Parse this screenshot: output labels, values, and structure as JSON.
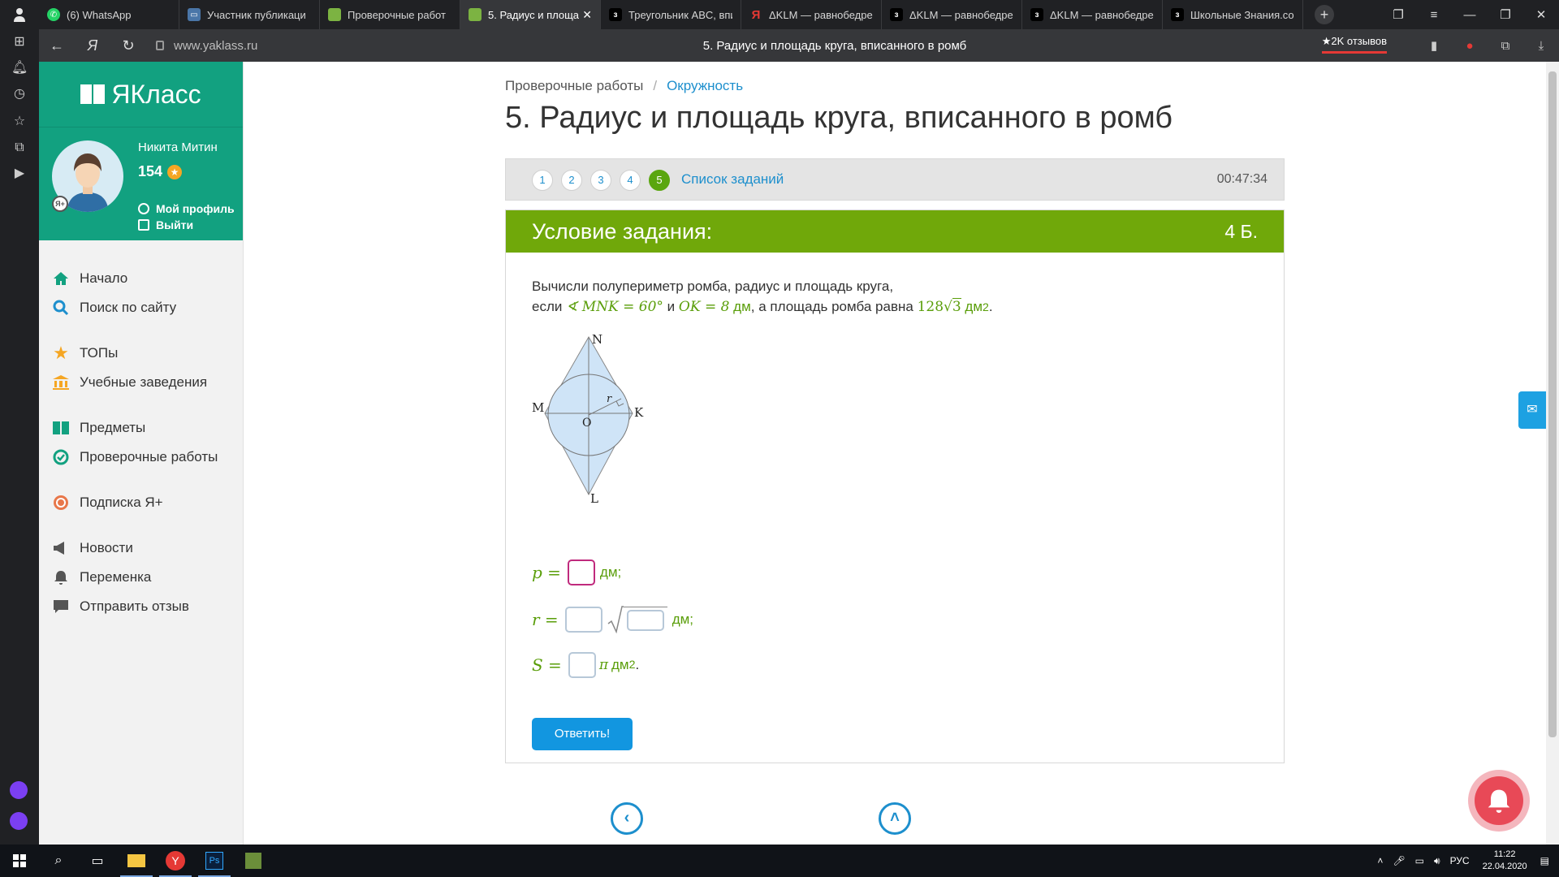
{
  "browser": {
    "tabs": [
      {
        "title": "(6) WhatsApp",
        "favicon": "whatsapp-icon",
        "color": "#25d366"
      },
      {
        "title": "Участник публикаци",
        "favicon": "vk-icon",
        "color": "#4a76a8"
      },
      {
        "title": "Проверочные работ",
        "favicon": "yaklass-icon",
        "color": "#7cb342"
      },
      {
        "title": "5. Радиус и площа,",
        "favicon": "yaklass-icon",
        "color": "#7cb342",
        "active": true
      },
      {
        "title": "Треугольник ABC, впи",
        "favicon": "znania-icon",
        "color": "#222"
      },
      {
        "title": "ΔKLM — равнобедре",
        "favicon": "yandex-icon",
        "color": "#e53935"
      },
      {
        "title": "ΔKLM — равнобедре",
        "favicon": "znania-icon",
        "color": "#222"
      },
      {
        "title": "ΔKLM — равнобедре",
        "favicon": "znania-icon",
        "color": "#222"
      },
      {
        "title": "Школьные Знания.со",
        "favicon": "znania-icon",
        "color": "#222"
      }
    ],
    "url": "www.yaklass.ru",
    "page_title": "5. Радиус и площадь круга, вписанного в ромб",
    "reviews": "★2K отзывов"
  },
  "logo": "ЯКласс",
  "user": {
    "name": "Никита Митин",
    "points": "154",
    "profile_link": "Мой профиль",
    "logout_link": "Выйти"
  },
  "menu": [
    {
      "label": "Начало",
      "icon": "home-icon"
    },
    {
      "label": "Поиск по сайту",
      "icon": "search-icon"
    },
    {
      "label": "ТОПы",
      "icon": "star-icon"
    },
    {
      "label": "Учебные заведения",
      "icon": "institution-icon"
    },
    {
      "label": "Предметы",
      "icon": "book-icon"
    },
    {
      "label": "Проверочные работы",
      "icon": "check-circle-icon"
    },
    {
      "label": "Подписка Я+",
      "icon": "subscription-icon"
    },
    {
      "label": "Новости",
      "icon": "megaphone-icon"
    },
    {
      "label": "Переменка",
      "icon": "bell-icon"
    },
    {
      "label": "Отправить отзыв",
      "icon": "chat-icon"
    }
  ],
  "breadcrumb": {
    "first": "Проверочные работы",
    "sep": "/",
    "second": "Окружность"
  },
  "title": "5. Радиус и площадь круга, вписанного в ромб",
  "task_nav": {
    "numbers": [
      "1",
      "2",
      "3",
      "4",
      "5"
    ],
    "current": "5",
    "list_label": "Список заданий",
    "timer": "00:47:34"
  },
  "card": {
    "header": "Условие задания:",
    "points": "4 Б.",
    "line1": "Вычисли полупериметр ромба, радиус и площадь круга,",
    "line2": {
      "if": "если",
      "angle": "∢ MNK = 60°",
      "and": "и",
      "ok": "OK = 8",
      "ok_unit": "дм",
      "area_text": ", а площадь ромба равна",
      "area_value": "128",
      "sqrt_arg": "3",
      "area_unit": "дм",
      "sup": "2"
    },
    "figure_labels": {
      "n": "N",
      "m": "M",
      "k": "K",
      "l": "L",
      "o": "O",
      "r": "r"
    },
    "answers": [
      {
        "var": "p =",
        "unit": "дм;"
      },
      {
        "var": "r =",
        "unit": "дм;"
      },
      {
        "var": "S =",
        "unit_pi": "π",
        "unit": "дм",
        "sup": "2",
        "end": "."
      }
    ],
    "submit": "Ответить!"
  },
  "taskbar": {
    "lang": "РУС",
    "time": "11:22",
    "date": "22.04.2020"
  }
}
